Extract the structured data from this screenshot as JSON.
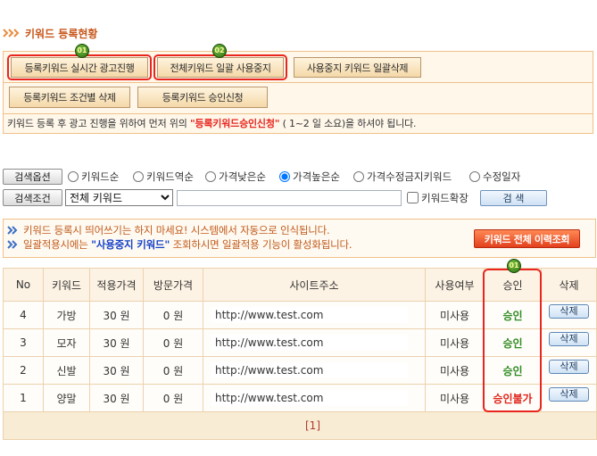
{
  "section_title": "키워드 등록현황",
  "action_panel": {
    "row1_buttons": [
      {
        "label": "등록키워드 실시간 광고진행",
        "badge": "01"
      },
      {
        "label": "전체키워드 일괄 사용중지",
        "badge": "02"
      },
      {
        "label": "사용중지 키워드 일괄삭제"
      }
    ],
    "row2_buttons": [
      {
        "label": "등록키워드 조건별 삭제"
      },
      {
        "label": "등록키워드 승인신청"
      }
    ],
    "notice": {
      "prefix": "키워드 등록 후 광고 진행을 위하여 먼저 위의 ",
      "highlight": "\"등록키워드승인신청\"",
      "suffix": " ( 1~2 일 소요)을 하셔야 됩니다."
    }
  },
  "search": {
    "options_button": "검색옵션",
    "sort_options": [
      {
        "label": "키워드순",
        "checked": false
      },
      {
        "label": "키워드역순",
        "checked": false
      },
      {
        "label": "가격낮은순",
        "checked": false
      },
      {
        "label": "가격높은순",
        "checked": true
      },
      {
        "label": "가격수정금지키워드",
        "checked": false
      },
      {
        "label": "수정일자",
        "checked": false
      }
    ],
    "condition_button": "검색조건",
    "condition_select": "전체 키워드",
    "keyword_input": "",
    "expand_label": "키워드확장",
    "expand_checked": false,
    "search_button": "검 색"
  },
  "info": {
    "line1": "키워드 등록시 띄어쓰기는 하지 마세요! 시스템에서 자동으로 인식됩니다.",
    "line2": {
      "prefix": "일괄적용시에는 ",
      "highlight": "\"사용중지 키워드\"",
      "suffix": " 조회하시면 일괄적용 기능이 활성화됩니다."
    },
    "history_button": "키워드 전체 이력조회"
  },
  "table": {
    "headers": [
      "No",
      "키워드",
      "적용가격",
      "방문가격",
      "사이트주소",
      "사용여부",
      "승인",
      "삭제"
    ],
    "approval_badge": "01",
    "rows": [
      {
        "no": "4",
        "keyword": "가방",
        "apply_price": "30 원",
        "visit_price": "0 원",
        "url": "http://www.test.com",
        "usage": "미사용",
        "approval": "승인",
        "approval_color": "#2e8b22",
        "delete": "삭제"
      },
      {
        "no": "3",
        "keyword": "모자",
        "apply_price": "30 원",
        "visit_price": "0 원",
        "url": "http://www.test.com",
        "usage": "미사용",
        "approval": "승인",
        "approval_color": "#2e8b22",
        "delete": "삭제"
      },
      {
        "no": "2",
        "keyword": "신발",
        "apply_price": "30 원",
        "visit_price": "0 원",
        "url": "http://www.test.com",
        "usage": "미사용",
        "approval": "승인",
        "approval_color": "#2e8b22",
        "delete": "삭제"
      },
      {
        "no": "1",
        "keyword": "양말",
        "apply_price": "30 원",
        "visit_price": "0 원",
        "url": "http://www.test.com",
        "usage": "미사용",
        "approval": "승인불가",
        "approval_color": "#e0231a",
        "delete": "삭제"
      }
    ],
    "pagination": "[1]"
  },
  "icons": {
    "title": "triple-chevron-icon",
    "info": "double-chevron-icon",
    "step_badge": "step-number-badge"
  },
  "colors": {
    "title": "#c8561a",
    "panel_border": "#f0c08a",
    "panel_bg": "#fff7ea",
    "highlight_red": "#e8261f",
    "info_text": "#c05a1c",
    "info_blue": "#1540c8",
    "table_border": "#ecd1ad",
    "pagination": "#b03a2e"
  }
}
